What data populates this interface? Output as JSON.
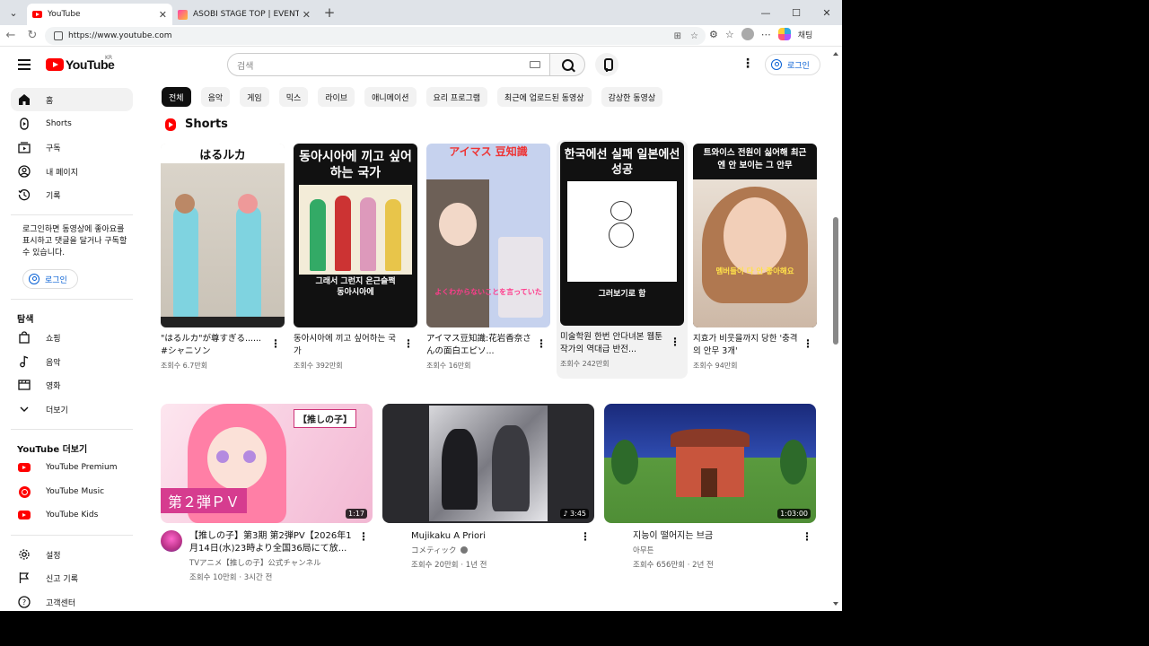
{
  "browser": {
    "tabs": [
      {
        "label": "YouTube",
        "active": true
      },
      {
        "label": "ASOBI STAGE TOP | EVENT | ASOBI",
        "active": false
      }
    ],
    "url": "https://www.youtube.com",
    "chat_label": "채팅"
  },
  "masthead": {
    "logo_text": "YouTube",
    "region": "KR",
    "search_placeholder": "검색",
    "signin_label": "로그인"
  },
  "sidebar": {
    "main": [
      {
        "label": "홈",
        "icon": "home-icon",
        "active": true
      },
      {
        "label": "Shorts",
        "icon": "shorts-icon"
      },
      {
        "label": "구독",
        "icon": "subscriptions-icon"
      },
      {
        "label": "내 페이지",
        "icon": "account-icon"
      },
      {
        "label": "기록",
        "icon": "history-icon"
      }
    ],
    "signin_note": "로그인하면 동영상에 좋아요를 표시하고 댓글을 달거나 구독할 수 있습니다.",
    "signin_label": "로그인",
    "explore_heading": "탐색",
    "explore": [
      {
        "label": "쇼핑",
        "icon": "shopping-icon"
      },
      {
        "label": "음악",
        "icon": "music-icon"
      },
      {
        "label": "영화",
        "icon": "movie-icon"
      },
      {
        "label": "더보기",
        "icon": "chevron-down-icon"
      }
    ],
    "more_heading": "YouTube 더보기",
    "more": [
      {
        "label": "YouTube Premium",
        "icon": "youtube-premium-icon"
      },
      {
        "label": "YouTube Music",
        "icon": "youtube-music-icon"
      },
      {
        "label": "YouTube Kids",
        "icon": "youtube-kids-icon"
      }
    ],
    "settings": [
      {
        "label": "설정",
        "icon": "gear-icon"
      },
      {
        "label": "신고 기록",
        "icon": "flag-icon"
      },
      {
        "label": "고객센터",
        "icon": "help-icon"
      }
    ]
  },
  "chips": [
    "전체",
    "음악",
    "게임",
    "믹스",
    "라이브",
    "애니메이션",
    "요리 프로그램",
    "최근에 업로드된 동영상",
    "감상한 동영상"
  ],
  "shorts": {
    "heading": "Shorts",
    "items": [
      {
        "title": "\"はるルカ\"が尊すぎる...... #シャニソン",
        "views": "조회수 6.7만회",
        "thumb_text": "はるルカ",
        "thumb_sub": "",
        "thumb_bg": "#e8e2d6"
      },
      {
        "title": "동아시아에 끼고 싶어하는 국가",
        "views": "조회수 392만회",
        "thumb_text": "동아시아에 끼고 싶어하는 국가",
        "thumb_sub": "그래서 그런지 은근슬쩍 동아시아에",
        "thumb_bg": "#111111"
      },
      {
        "title": "アイマス豆知識:花岩香奈さんの面白エピソ...",
        "views": "조회수 16만회",
        "thumb_text": "アイマス 豆知識",
        "thumb_sub": "よくわからないことを言っていた",
        "thumb_bg": "#b9c7e8"
      },
      {
        "title": "미술학원 한번 안다녀본 웹툰작가의 역대급 반전...",
        "views": "조회수 242만회",
        "thumb_text": "한국에선 실패 일본에선 성공",
        "thumb_sub": "그러보기로 함",
        "thumb_bg": "#111111"
      },
      {
        "title": "지효가 비웃을까지 당한 '충격의 안무 3개'",
        "views": "조회수 94만회",
        "thumb_text": "트와이스 전원이 싫어해 최근엔 안 보이는 그 안무",
        "thumb_sub": "멤버들이 다 안 좋아해요",
        "thumb_bg": "#111111"
      }
    ]
  },
  "videos": [
    {
      "title": "【推しの子】第3期 第2弾PV【2026年1月14日(水)23時より全国36局にて放...",
      "channel": "TVアニメ【推しの子】公式チャンネル",
      "stats": "조회수 10만회 · 3시간 전",
      "duration": "1:17",
      "thumb_text": "第２弾ＰＶ",
      "thumb_badge": "【推しの子】"
    },
    {
      "title": "Mujikaku A Priori",
      "channel": "コメティック",
      "stats": "조회수 20만회 · 1년 전",
      "duration": "3:45"
    },
    {
      "title": "지능이 떨어지는 브금",
      "channel": "아무튼",
      "stats": "조회수 656만회 · 2년 전",
      "duration": "1:03:00"
    }
  ]
}
